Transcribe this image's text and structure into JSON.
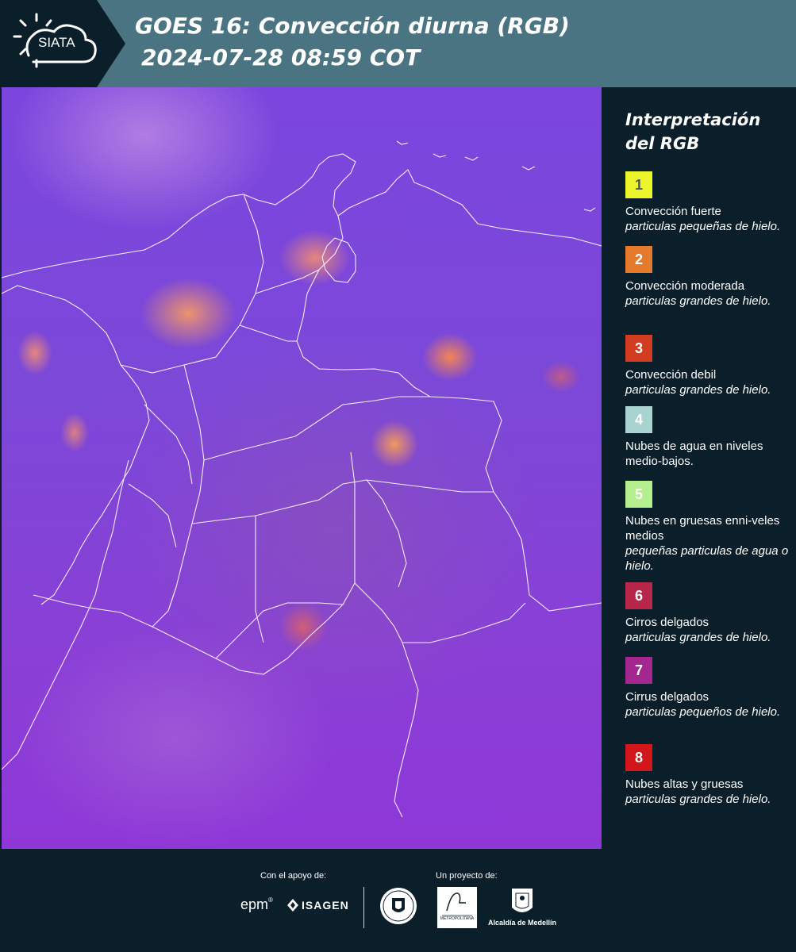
{
  "header": {
    "logo_text": "SIATA",
    "title_line1": "GOES 16: Convección diurna (RGB)",
    "title_line2": "2024-07-28 08:59 COT"
  },
  "map": {
    "description_icon": "satellite-map",
    "background_color": "#7b45de",
    "border_color": "#ffffff"
  },
  "legend": {
    "title": "Interpretación del RGB",
    "items": [
      {
        "number": "1",
        "color": "#ecf52a",
        "text_color": "#555555",
        "name": "Convección fuerte",
        "desc": "particulas pequeñas de hielo."
      },
      {
        "number": "2",
        "color": "#e47a2b",
        "text_color": "#ffffff",
        "name": "Convección moderada",
        "desc": "particulas grandes de hielo."
      },
      {
        "number": "3",
        "color": "#d23c20",
        "text_color": "#ffffff",
        "name": "Convección debil",
        "desc": "particulas grandes de hielo."
      },
      {
        "number": "4",
        "color": "#a9d3d0",
        "text_color": "#ffffff",
        "name": "Nubes de agua en niveles medio-bajos.",
        "desc": ""
      },
      {
        "number": "5",
        "color": "#b5ee8c",
        "text_color": "#ffffff",
        "name": "Nubes en gruesas enni-veles medios",
        "desc": "pequeñas particulas de agua o hielo."
      },
      {
        "number": "6",
        "color": "#b8264a",
        "text_color": "#ffffff",
        "name": "Cirros delgados",
        "desc": "particulas grandes de hielo."
      },
      {
        "number": "7",
        "color": "#a4268f",
        "text_color": "#ffffff",
        "name": "Cirrus delgados",
        "desc": "particulas pequeños de hielo."
      },
      {
        "number": "8",
        "color": "#d3161c",
        "text_color": "#ffffff",
        "name": "Nubes altas y gruesas",
        "desc": "particulas grandes de hielo."
      }
    ]
  },
  "footer": {
    "support_label": "Con el apoyo de:",
    "project_label": "Un proyecto de:",
    "epm": "epm",
    "isagen": "ISAGEN",
    "area_text": "METROPOLITANA",
    "alcaldia": "Alcaldía de Medellín"
  }
}
